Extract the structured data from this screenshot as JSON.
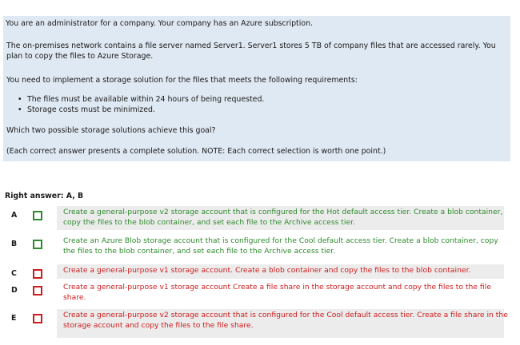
{
  "intro": "You are an administrator for a company. Your company has an Azure subscription.",
  "question": {
    "p1": "The on-premises network contains a file server named Server1. Server1 stores 5 TB of company files that are accessed rarely. You plan to copy the files to Azure Storage.",
    "p2": "You need to implement a storage solution for the files that meets the following requirements:",
    "requirements": [
      "The files must be available within 24 hours of being requested.",
      "Storage costs must be minimized."
    ],
    "p3": "Which two possible storage solutions achieve this goal?",
    "p4": "(Each correct answer presents a complete solution. NOTE: Each correct selection is worth one point.)"
  },
  "right_answer": "Right answer: A, B",
  "options": [
    {
      "letter": "A",
      "status": "correct",
      "text": "Create a general-purpose v2 storage account that is configured for the Hot default access tier. Create a blob container, copy the files to the blob container, and set each file to the Archive access tier."
    },
    {
      "letter": "B",
      "status": "correct",
      "text": "Create an Azure Blob storage account that is configured for the Cool default access tier. Create a blob container, copy the files to the blob container, and set each file to the Archive access tier."
    },
    {
      "letter": "C",
      "status": "incorrect",
      "text": "Create a general-purpose v1 storage account. Create a blob container and copy the files to the blob container."
    },
    {
      "letter": "D",
      "status": "incorrect",
      "text": "Create a general-purpose v1 storage account Create a file share in the storage account and copy the files to the file share."
    },
    {
      "letter": "E",
      "status": "incorrect",
      "text": "Create a general-purpose v2 storage account that is configured for the Cool default access tier. Create a file share in the storage account and copy the files to the file share."
    }
  ],
  "colors": {
    "correct": "#2e8a2e",
    "incorrect": "#cc1d1d",
    "question_bg": "#dfe9f3",
    "option_bg": "#ececec"
  }
}
